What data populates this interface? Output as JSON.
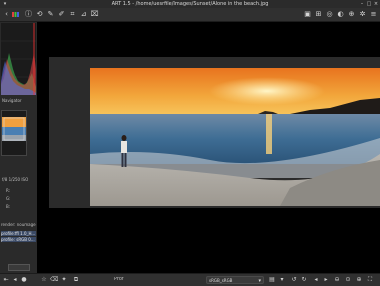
{
  "window": {
    "title": "ART 1.5 - /home/uesrfile/Images/Sunset/Alone in the beach.jpg"
  },
  "left_panel": {
    "section_label": "Navigator",
    "info_line": "f/8 1/250 ISO",
    "rows": [
      "R:",
      "G:",
      "B:"
    ],
    "meta": [
      "render: noumage",
      "profile:ffl 1.0_H...",
      "profile: sRGB 0..."
    ]
  },
  "bottombar": {
    "label": "Prof",
    "profile": "sRGB_sRGB"
  },
  "icons": {
    "toolbar_left": [
      "info-icon",
      "history-icon",
      "color-picker-icon",
      "crop-icon",
      "straighten-icon",
      "transform-icon"
    ],
    "toolbar_right": [
      "save-icon",
      "grid-icon",
      "zoom-fit-icon",
      "zoom-in-icon",
      "preview-icon",
      "settings-icon",
      "menu-icon"
    ],
    "bottom": [
      "nav-first-icon",
      "nav-prev-icon",
      "rotate-left-icon",
      "rotate-right-icon",
      "zoom-out-icon",
      "zoom-in-icon"
    ]
  }
}
